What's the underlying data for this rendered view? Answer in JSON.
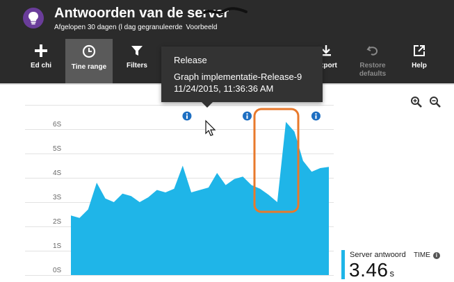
{
  "header": {
    "title": "Antwoorden van de server",
    "subtitle": "Afgelopen 30 dagen (l dag gegranuleerde",
    "sample": "Voorbeeld"
  },
  "toolbar": {
    "buttons": [
      {
        "label": "Ed chi",
        "icon": "plus-icon"
      },
      {
        "label": "Tine range",
        "icon": "clock-icon"
      },
      {
        "label": "Filters",
        "icon": "filter-icon"
      },
      {
        "label": "Export",
        "icon": "download-icon"
      },
      {
        "label": "Restore defaults",
        "icon": "undo-icon"
      },
      {
        "label": "Help",
        "icon": "external-link-icon"
      }
    ]
  },
  "tooltip": {
    "title": "Release",
    "line1": "Graph implementatie-Release-9",
    "line2": "11/24/2015, 11:36:36 AM"
  },
  "colors": {
    "area": "#1fb5e8",
    "header_bg": "#2b2b2b",
    "highlight": "#e8792b",
    "marker": "#1e6fc2"
  },
  "chart_data": {
    "type": "area",
    "y_ticks": [
      "0S",
      "1S",
      "2S",
      "3S",
      "4S",
      "5S",
      "6S"
    ],
    "ylim": [
      0,
      7
    ],
    "x": [
      0,
      1,
      2,
      3,
      4,
      5,
      6,
      7,
      8,
      9,
      10,
      11,
      12,
      13,
      14,
      15,
      16,
      17,
      18,
      19,
      20,
      21,
      22,
      23,
      24,
      25,
      26,
      27,
      28,
      29,
      30
    ],
    "values": [
      2.45,
      2.35,
      2.7,
      3.8,
      3.15,
      3.0,
      3.35,
      3.25,
      3.0,
      3.2,
      3.5,
      3.4,
      3.55,
      4.5,
      3.4,
      3.5,
      3.6,
      4.2,
      3.7,
      3.95,
      4.05,
      3.7,
      3.55,
      3.3,
      3.0,
      6.3,
      5.9,
      4.7,
      4.25,
      4.4,
      4.45
    ],
    "release_markers": [
      13.5,
      20.5,
      28.5
    ],
    "grid": true,
    "legend": {
      "name": "Server antwoord",
      "value": "3.46",
      "unit": "s"
    },
    "time_label": "TIME"
  }
}
